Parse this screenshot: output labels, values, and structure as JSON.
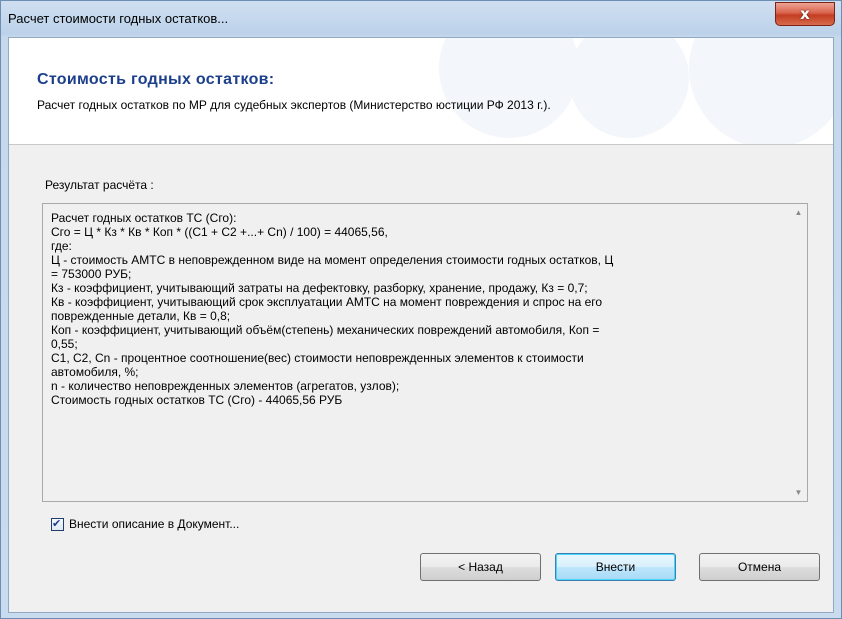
{
  "window": {
    "title": "Расчет стоимости годных остатков...",
    "close_glyph": "x"
  },
  "header": {
    "title": "Стоимость годных остатков:",
    "subtitle": "Расчет годных остатков по МР для судебных экспертов (Министерство юстиции РФ 2013 г.)."
  },
  "result": {
    "label": "Результат расчёта :",
    "text": "Расчет годных остатков ТС (Сго):\nСго = Ц * Кз * Кв * Коп * ((С1 + С2 +...+ Сn) / 100) = 44065,56,\nгде:\nЦ - стоимость АМТС в неповрежденном виде на момент определения стоимости годных остатков, Ц\n= 753000 РУБ;\nКз - коэффициент, учитывающий затраты на дефектовку, разборку, хранение, продажу, Кз = 0,7;\nКв - коэффициент, учитывающий срок эксплуатации АМТС на момент повреждения и спрос на его\nповрежденные детали, Кв = 0,8;\nКоп - коэффициент, учитывающий объём(степень) механических повреждений автомобиля, Коп =\n0,55;\nС1, С2, Сn - процентное соотношение(вес) стоимости неповрежденных элементов к стоимости\nавтомобиля, %;\nn - количество неповрежденных элементов (агрегатов, узлов);\nСтоимость годных остатков ТС (Сго) - 44065,56 РУБ"
  },
  "checkbox": {
    "label": "Внести описание в Документ...",
    "checked": true
  },
  "buttons": {
    "back": "< Назад",
    "apply": "Внести",
    "cancel": "Отмена"
  }
}
